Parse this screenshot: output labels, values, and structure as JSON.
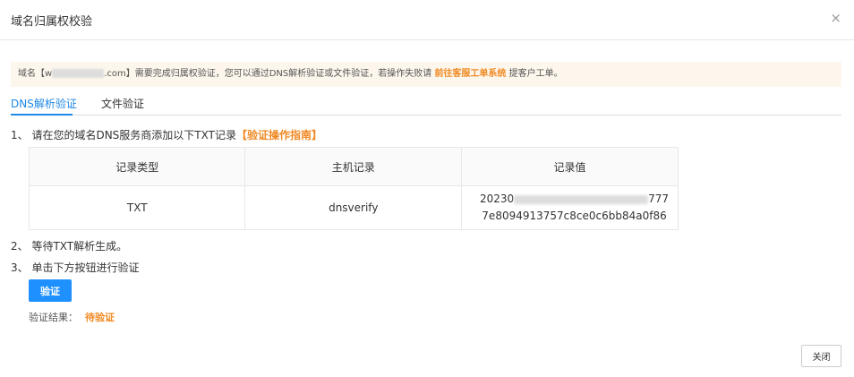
{
  "dialog": {
    "title": "域名归属权校验",
    "close_icon": "×"
  },
  "notice": {
    "prefix": "域名【w",
    "domain_suffix": ".com】需要完成归属权验证，您可以通过DNS解析验证或文件验证，若操作失败请 ",
    "link": "前往客服工单系统",
    "suffix": " 提客户工单。"
  },
  "tabs": [
    {
      "label": "DNS解析验证",
      "active": true
    },
    {
      "label": "文件验证",
      "active": false
    }
  ],
  "steps": {
    "step1": "1、 请在您的域名DNS服务商添加以下TXT记录",
    "step1_link": "【验证操作指南】",
    "step2": "2、 等待TXT解析生成。",
    "step3": "3、 单击下方按钮进行验证"
  },
  "table": {
    "headers": [
      "记录类型",
      "主机记录",
      "记录值"
    ],
    "row": {
      "type": "TXT",
      "host": "dnsverify",
      "value_start": "20230",
      "value_end": "777",
      "value_line2": "7e8094913757c8ce0c6bb84a0f86"
    }
  },
  "verify_button": "验证",
  "result": {
    "label": "验证结果：",
    "status": "待验证"
  },
  "close_button": "关闭",
  "colors": {
    "accent": "#1e88e5",
    "link": "#f08a24",
    "button": "#1e90ff"
  }
}
